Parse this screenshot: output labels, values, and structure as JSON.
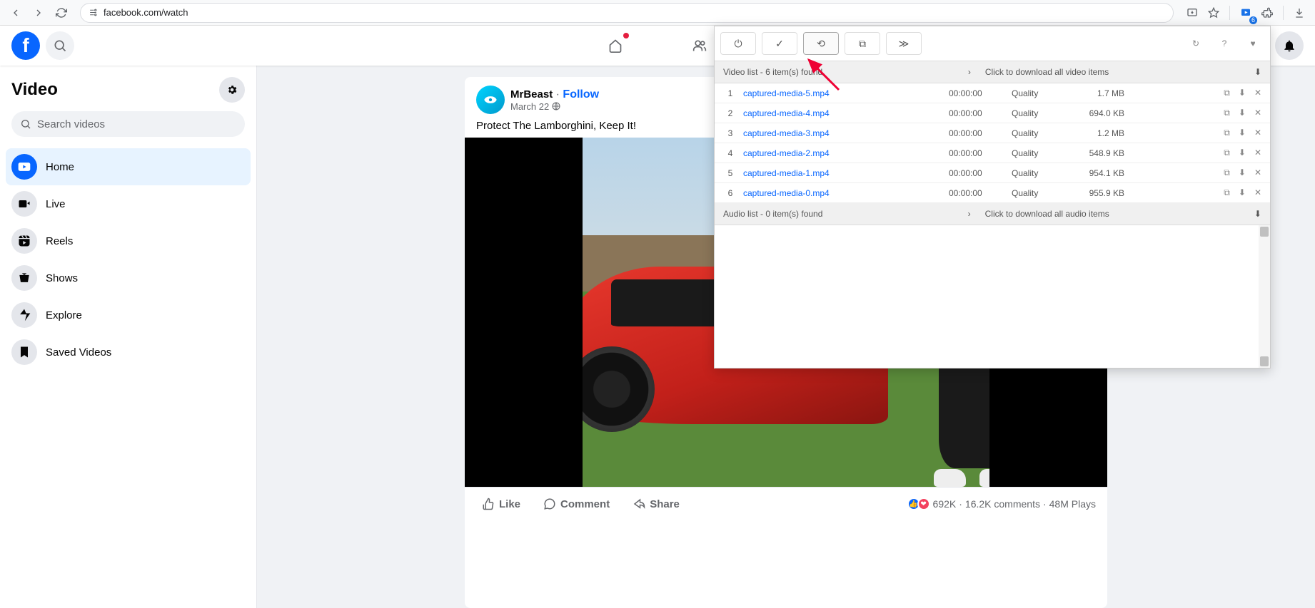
{
  "browser": {
    "url": "facebook.com/watch",
    "ext_count": "6"
  },
  "fb": {
    "sidebar_title": "Video",
    "search_placeholder": "Search videos",
    "items": [
      {
        "label": "Home"
      },
      {
        "label": "Live"
      },
      {
        "label": "Reels"
      },
      {
        "label": "Shows"
      },
      {
        "label": "Explore"
      },
      {
        "label": "Saved Videos"
      }
    ]
  },
  "post": {
    "author": "MrBeast",
    "follow": "Follow",
    "date": "March 22",
    "title": "Protect The Lamborghini, Keep It!",
    "like": "Like",
    "comment": "Comment",
    "share": "Share",
    "reactions": "692K",
    "comments_count": "16.2K comments",
    "plays": "48M Plays"
  },
  "ext": {
    "video_header": "Video list - 6 item(s) found",
    "video_dl": "Click to download all video items",
    "audio_header": "Audio list - 0 item(s) found",
    "audio_dl": "Click to download all audio items",
    "rows": [
      {
        "idx": "1",
        "name": "captured-media-5.mp4",
        "dur": "00:00:00",
        "qual": "Quality",
        "size": "1.7 MB"
      },
      {
        "idx": "2",
        "name": "captured-media-4.mp4",
        "dur": "00:00:00",
        "qual": "Quality",
        "size": "694.0 KB"
      },
      {
        "idx": "3",
        "name": "captured-media-3.mp4",
        "dur": "00:00:00",
        "qual": "Quality",
        "size": "1.2 MB"
      },
      {
        "idx": "4",
        "name": "captured-media-2.mp4",
        "dur": "00:00:00",
        "qual": "Quality",
        "size": "548.9 KB"
      },
      {
        "idx": "5",
        "name": "captured-media-1.mp4",
        "dur": "00:00:00",
        "qual": "Quality",
        "size": "954.1 KB"
      },
      {
        "idx": "6",
        "name": "captured-media-0.mp4",
        "dur": "00:00:00",
        "qual": "Quality",
        "size": "955.9 KB"
      }
    ]
  }
}
